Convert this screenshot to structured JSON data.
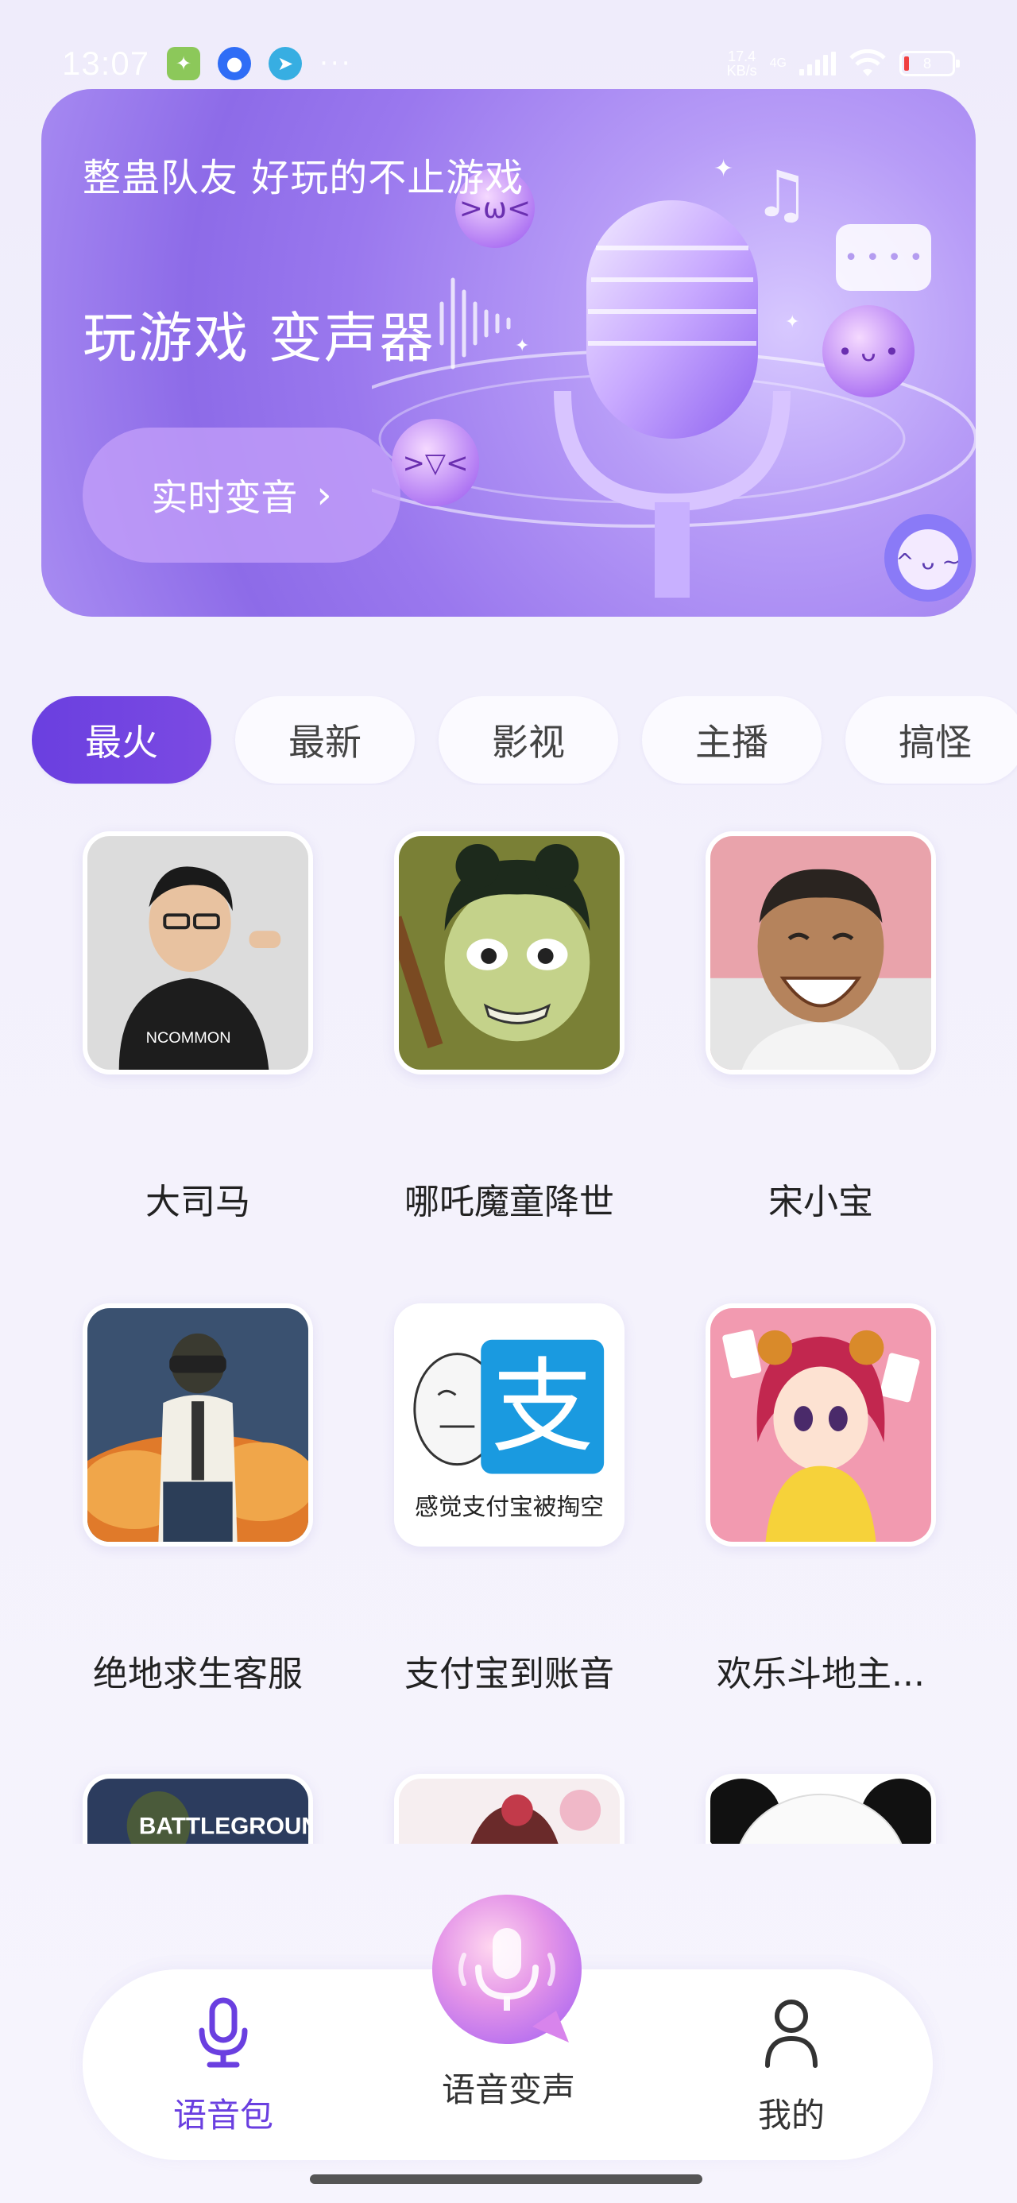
{
  "status_bar": {
    "time": "13:07",
    "apps": [
      "app-icon-green",
      "app-icon-blue",
      "telegram-icon"
    ],
    "more": "···",
    "speed_value": "17.4",
    "speed_unit": "KB/s",
    "network": "4G",
    "battery": "8"
  },
  "banner": {
    "subtitle": "整蛊队友 好玩的不止游戏",
    "title": "玩游戏 变声器",
    "button_label": "实时变音",
    "button_chevron": "›"
  },
  "tabs": [
    {
      "label": "最火",
      "active": true
    },
    {
      "label": "最新",
      "active": false
    },
    {
      "label": "影视",
      "active": false
    },
    {
      "label": "主播",
      "active": false
    },
    {
      "label": "搞怪",
      "active": false
    }
  ],
  "voice_packs": [
    {
      "label": "大司马",
      "thumb": "man-black-shirt"
    },
    {
      "label": "哪吒魔童降世",
      "thumb": "nezha-character"
    },
    {
      "label": "宋小宝",
      "thumb": "laughing-man"
    },
    {
      "label": "绝地求生客服",
      "thumb": "pubg-soldier"
    },
    {
      "label": "支付宝到账音",
      "thumb": "alipay-meme",
      "thumb_text": "感觉支付宝被掏空",
      "thumb_glyph": "支"
    },
    {
      "label": "欢乐斗地主...",
      "thumb": "anime-girl-cards"
    },
    {
      "label": "",
      "thumb": "battlegrounds-cover",
      "thumb_text": "BATTLEGROUNDS"
    },
    {
      "label": "",
      "thumb": "anime-girl-flowers"
    },
    {
      "label": "",
      "thumb": "panda-meme"
    }
  ],
  "bottom_nav": {
    "voice_pack": "语音包",
    "voice_change": "语音变声",
    "mine": "我的"
  },
  "colors": {
    "accent": "#6a3fe0",
    "banner": "#9a78ee",
    "background": "#efecfb"
  }
}
